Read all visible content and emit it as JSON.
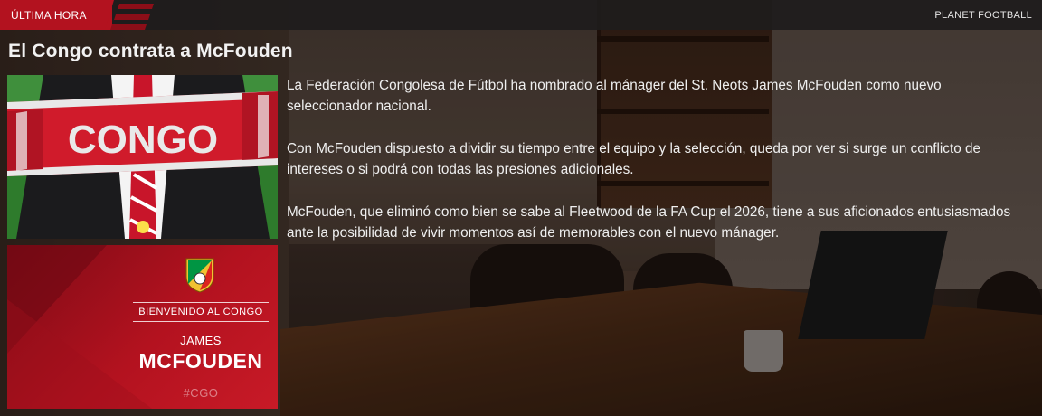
{
  "topbar": {
    "tag_label": "ÚLTIMA HORA",
    "source": "PLANET FOOTBALL"
  },
  "headline": "El Congo contrata a McFouden",
  "photo": {
    "scarf_text": "CONGO"
  },
  "graphic": {
    "welcome": "BIENVENIDO AL CONGO",
    "first_name": "JAMES",
    "last_name": "MCFOUDEN",
    "hashtag": "#CGO"
  },
  "article": {
    "paragraphs": [
      "La Federación Congolesa de Fútbol ha nombrado al mánager del St. Neots James McFouden como nuevo seleccionador nacional.",
      "Con McFouden dispuesto a dividir su tiempo entre el equipo y la selección, queda por ver si surge un conflicto de intereses o si podrá con todas las presiones adicionales.",
      "McFouden, que eliminó como bien se sabe al Fleetwood de la FA Cup el 2026, tiene a sus aficionados entusiasmados ante la posibilidad de vivir momentos así de memorables con el nuevo mánager."
    ]
  },
  "colors": {
    "accent": "#b3121f",
    "congo_green": "#009543",
    "congo_yellow": "#fbde4a",
    "congo_red": "#dc241f"
  }
}
